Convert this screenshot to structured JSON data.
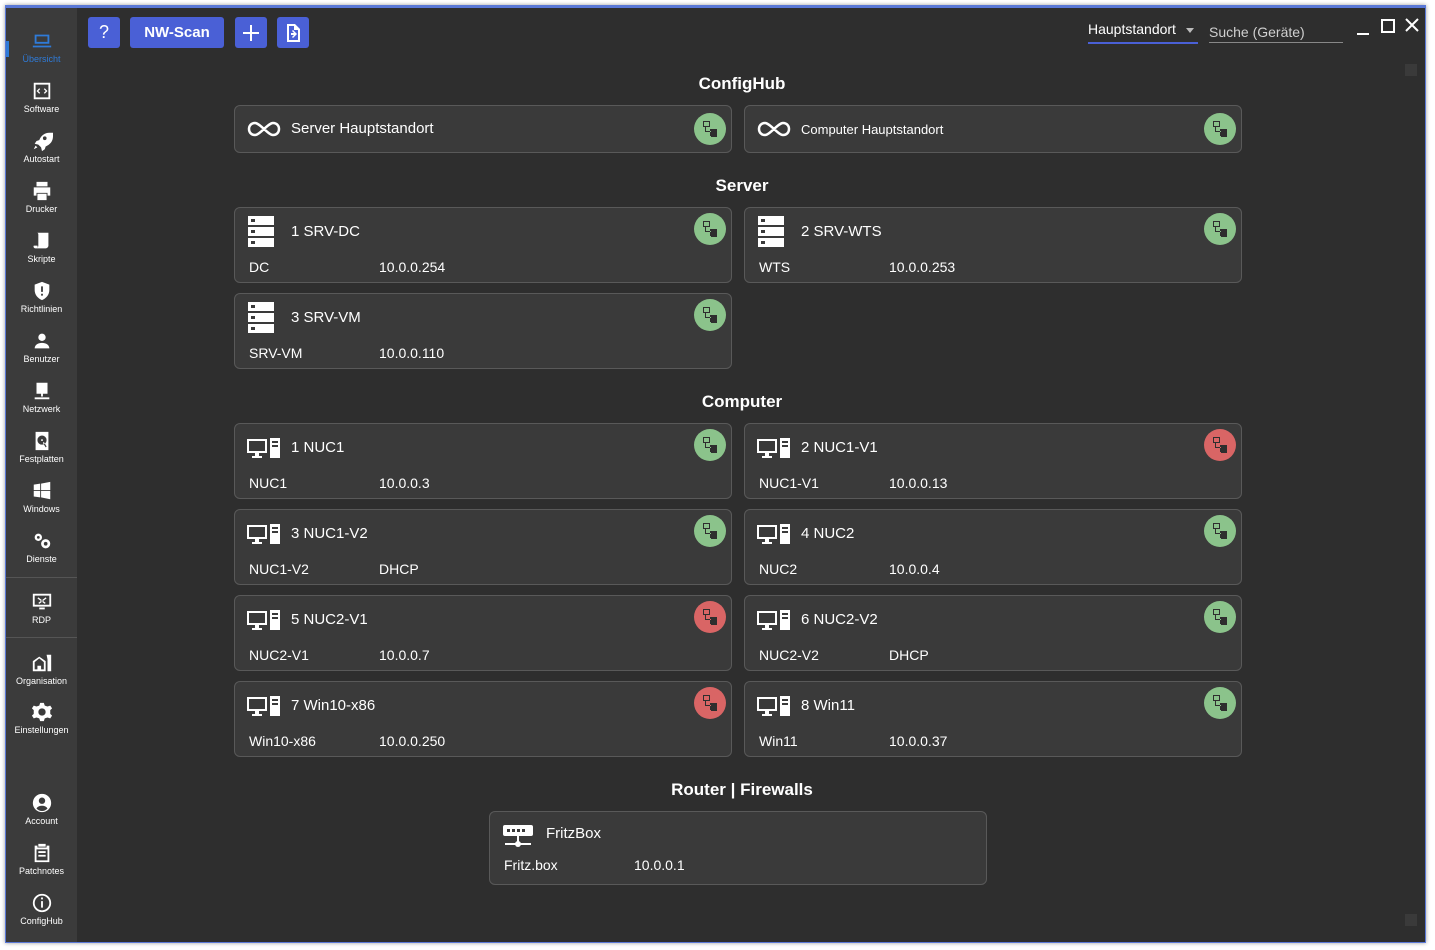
{
  "sidebar": {
    "items": [
      {
        "label": "Übersicht",
        "icon": "laptop-icon"
      },
      {
        "label": "Software",
        "icon": "code-icon"
      },
      {
        "label": "Autostart",
        "icon": "rocket-icon"
      },
      {
        "label": "Drucker",
        "icon": "printer-icon"
      },
      {
        "label": "Skripte",
        "icon": "script-icon"
      },
      {
        "label": "Richtlinien",
        "icon": "shield-icon"
      },
      {
        "label": "Benutzer",
        "icon": "user-icon"
      },
      {
        "label": "Netzwerk",
        "icon": "network-icon"
      },
      {
        "label": "Festplatten",
        "icon": "harddisk-icon"
      },
      {
        "label": "Windows",
        "icon": "windows-icon"
      },
      {
        "label": "Dienste",
        "icon": "gears-icon"
      },
      {
        "label": "RDP",
        "icon": "remote-desktop-icon"
      },
      {
        "label": "Organisation",
        "icon": "building-icon"
      },
      {
        "label": "Einstellungen",
        "icon": "gear-icon"
      },
      {
        "label": "Account",
        "icon": "account-icon"
      },
      {
        "label": "Patchnotes",
        "icon": "clipboard-icon"
      },
      {
        "label": "ConfigHub",
        "icon": "info-icon"
      }
    ]
  },
  "toolbar": {
    "help_label": "?",
    "scan_label": "NW-Scan",
    "location": "Hauptstandort",
    "search_placeholder": "Suche (Geräte)"
  },
  "sections": {
    "confighub": "ConfigHub",
    "server": "Server",
    "computer": "Computer",
    "router": "Router | Firewalls"
  },
  "confighub_cards": [
    {
      "name": "Server Hauptstandort",
      "status": "ok"
    },
    {
      "name": "Computer Hauptstandort",
      "status": "ok"
    }
  ],
  "servers": [
    {
      "name": "1 SRV-DC",
      "host": "DC",
      "ip": "10.0.0.254",
      "status": "ok"
    },
    {
      "name": "2 SRV-WTS",
      "host": "WTS",
      "ip": "10.0.0.253",
      "status": "ok"
    },
    {
      "name": "3 SRV-VM",
      "host": "SRV-VM",
      "ip": "10.0.0.110",
      "status": "ok"
    }
  ],
  "computers": [
    {
      "name": "1 NUC1",
      "host": "NUC1",
      "ip": "10.0.0.3",
      "status": "ok"
    },
    {
      "name": "2 NUC1-V1",
      "host": "NUC1-V1",
      "ip": "10.0.0.13",
      "status": "bad"
    },
    {
      "name": "3 NUC1-V2",
      "host": "NUC1-V2",
      "ip": "DHCP",
      "status": "ok"
    },
    {
      "name": "4 NUC2",
      "host": "NUC2",
      "ip": "10.0.0.4",
      "status": "ok"
    },
    {
      "name": "5 NUC2-V1",
      "host": "NUC2-V1",
      "ip": "10.0.0.7",
      "status": "bad"
    },
    {
      "name": "6 NUC2-V2",
      "host": "NUC2-V2",
      "ip": "DHCP",
      "status": "ok"
    },
    {
      "name": "7 Win10-x86",
      "host": "Win10-x86",
      "ip": "10.0.0.250",
      "status": "bad"
    },
    {
      "name": "8 Win11",
      "host": "Win11",
      "ip": "10.0.0.37",
      "status": "ok"
    }
  ],
  "routers": [
    {
      "name": "FritzBox",
      "host": "Fritz.box",
      "ip": "10.0.0.1"
    }
  ],
  "colors": {
    "accent": "#4a60d6",
    "active_nav": "#2f7bd8",
    "status_ok": "#8bc38b",
    "status_bad": "#d96565",
    "card_bg": "#3a3a3a",
    "window_bg": "#2e2e2e"
  }
}
